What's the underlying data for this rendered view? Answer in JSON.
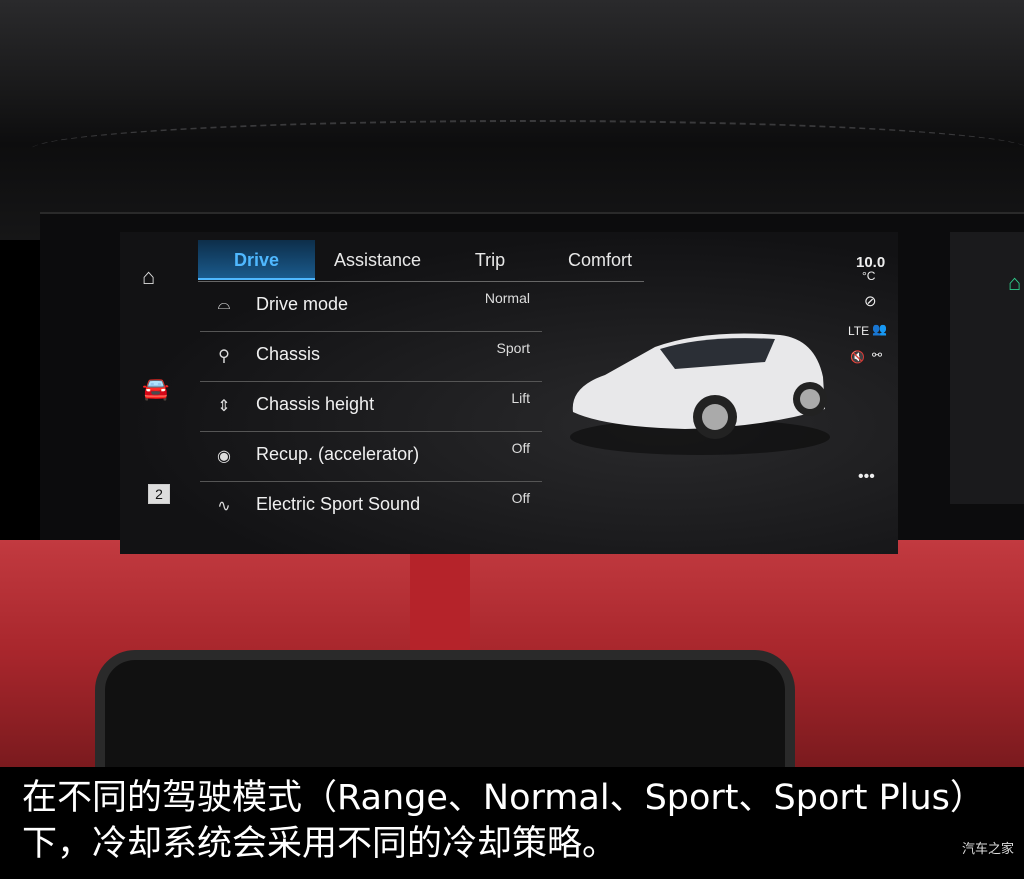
{
  "rail": {
    "home_icon": "home-icon",
    "car_icon": "car-icon",
    "badge": "2"
  },
  "tabs": [
    {
      "label": "Drive",
      "active": true
    },
    {
      "label": "Assistance"
    },
    {
      "label": "Trip"
    },
    {
      "label": "Comfort"
    }
  ],
  "settings": [
    {
      "label": "Drive mode",
      "value": "Normal",
      "icon": "car-outline-icon"
    },
    {
      "label": "Chassis",
      "value": "Sport",
      "icon": "shock-absorber-icon"
    },
    {
      "label": "Chassis height",
      "value": "Lift",
      "icon": "chassis-height-icon"
    },
    {
      "label": "Recup. (accelerator)",
      "value": "Off",
      "icon": "recuperation-icon"
    },
    {
      "label": "Electric Sport Sound",
      "value": "Off",
      "icon": "sound-wave-icon"
    }
  ],
  "status": {
    "temperature": "10.0",
    "unit": "°C",
    "network": "LTE"
  },
  "caption": {
    "line1": "在不同的驾驶模式（Range、Normal、Sport、Sport Plus）",
    "line2": "下，冷却系统会采用不同的冷却策略。"
  },
  "watermark": "汽车之家",
  "colors": {
    "accent": "#4fb8ff",
    "interior": "#b5232a",
    "secondary_home": "#2ecc8a"
  }
}
